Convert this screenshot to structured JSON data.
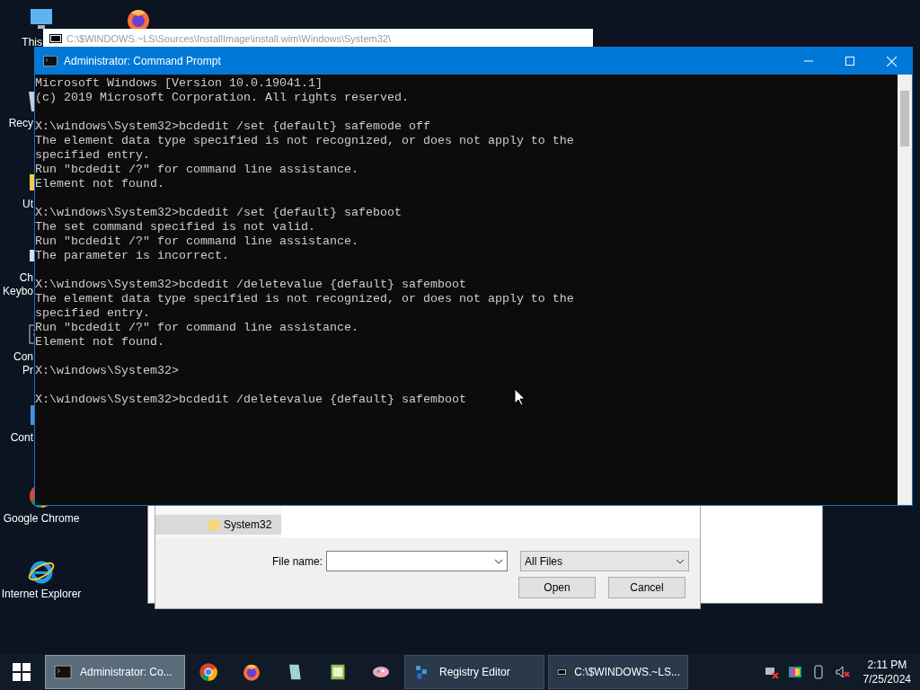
{
  "desktop_icons": [
    {
      "kind": "pc",
      "label": "This"
    },
    {
      "kind": "firefox"
    },
    {
      "kind": "recycle",
      "label": "Recy"
    },
    {
      "kind": "folder",
      "label": "Ut"
    },
    {
      "kind": "keyboard",
      "label": "Ch",
      "label2": "Keybo"
    },
    {
      "kind": "cmd",
      "label": "Con",
      "label2": "Pr"
    },
    {
      "kind": "control",
      "label": "Cont"
    },
    {
      "kind": "chrome",
      "label": "Google Chrome"
    },
    {
      "kind": "ie",
      "label": "Internet Explorer"
    }
  ],
  "back_window": {
    "title": "C:\\$WINDOWS.~LS\\Sources\\InstallImage\\install.wim\\Windows\\System32\\"
  },
  "open_dialog": {
    "nav_items": [
      {
        "label": "System32",
        "selected": true
      }
    ],
    "file_name_label": "File name:",
    "file_type": "All Files",
    "buttons": [
      "Open",
      "Cancel"
    ]
  },
  "console_window": {
    "title": "Administrator: Command Prompt",
    "blocks": [
      [
        "Microsoft Windows [Version 10.0.19041.1]",
        "(c) 2019 Microsoft Corporation. All rights reserved."
      ],
      [
        "X:\\windows\\System32>bcdedit /set {default} safemode off",
        "The element data type specified is not recognized, or does not apply to the",
        "specified entry.",
        "Run \"bcdedit /?\" for command line assistance.",
        "Element not found."
      ],
      [
        "X:\\windows\\System32>bcdedit /set {default} safeboot",
        "The set command specified is not valid.",
        "Run \"bcdedit /?\" for command line assistance.",
        "The parameter is incorrect."
      ],
      [
        "X:\\windows\\System32>bcdedit /deletevalue {default} safemboot",
        "The element data type specified is not recognized, or does not apply to the",
        "specified entry.",
        "Run \"bcdedit /?\" for command line assistance.",
        "Element not found."
      ],
      [
        "X:\\windows\\System32>"
      ],
      [
        "X:\\windows\\System32>bcdedit /deletevalue {default} safemboot"
      ]
    ]
  },
  "taskbar": {
    "items": [
      {
        "kind": "cmd",
        "label": "Administrator: Co...",
        "selected": true
      },
      {
        "kind": "chrome"
      },
      {
        "kind": "firefox"
      },
      {
        "kind": "notepad"
      },
      {
        "kind": "sheet"
      },
      {
        "kind": "paint"
      },
      {
        "kind": "registry",
        "label": "Registry Editor",
        "selected": false
      },
      {
        "kind": "archive",
        "label": "C:\\$WINDOWS.~LS...",
        "selected": false
      }
    ],
    "time": "2:11 PM",
    "date": "7/25/2024"
  }
}
